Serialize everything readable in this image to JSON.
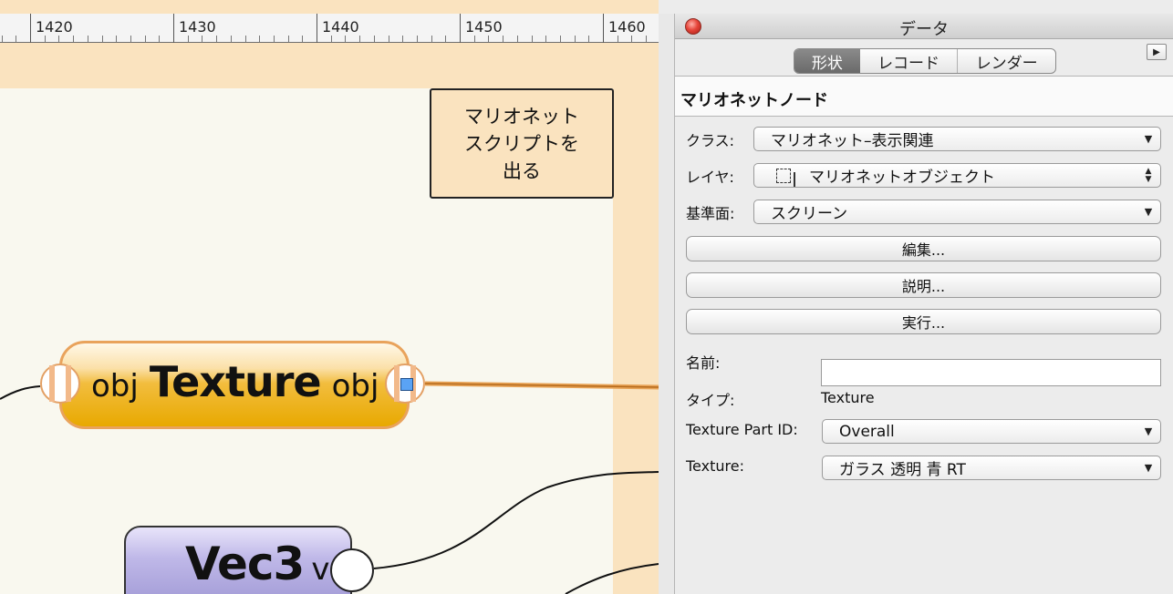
{
  "ruler": {
    "labels": [
      "1420",
      "1430",
      "1440",
      "1450",
      "1460"
    ]
  },
  "canvas": {
    "comment_lines": [
      "マリオネット",
      "スクリプトを",
      "出る"
    ],
    "texture_node": {
      "input_label": "obj",
      "name": "Texture",
      "output_label": "obj"
    },
    "vec3_node": {
      "name": "Vec3",
      "output_label": "v"
    }
  },
  "palette": {
    "title": "データ",
    "tabs": [
      {
        "label": "形状",
        "active": true
      },
      {
        "label": "レコード",
        "active": false
      },
      {
        "label": "レンダー",
        "active": false
      }
    ],
    "section_title": "マリオネットノード",
    "fields": {
      "class_label": "クラス:",
      "class_value": "マリオネット–表示関連",
      "layer_label": "レイヤ:",
      "layer_value": "マリオネットオブジェクト",
      "plane_label": "基準面:",
      "plane_value": "スクリーン",
      "name_label": "名前:",
      "name_value": "",
      "type_label": "タイプ:",
      "type_value": "Texture",
      "part_label": "Texture Part ID:",
      "part_value": "Overall",
      "texture_label": "Texture:",
      "texture_value": "ガラス 透明 青 RT"
    },
    "buttons": {
      "edit": "編集...",
      "describe": "説明...",
      "run": "実行..."
    }
  },
  "colors": {
    "texture_node": "#e8a900",
    "vec3_node": "#9b94d2",
    "canvas_band": "#fae3bf",
    "selection_handle": "#5aa3f5"
  }
}
